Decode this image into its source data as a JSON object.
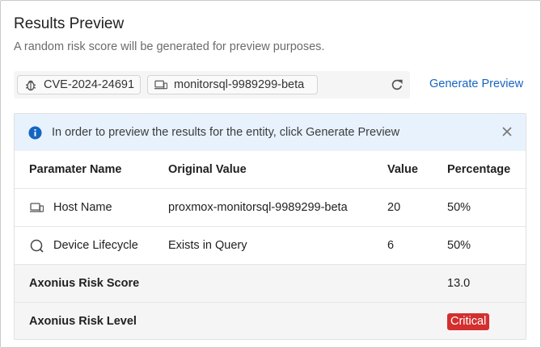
{
  "header": {
    "title": "Results Preview",
    "subtitle": "A random risk score will be generated for preview purposes."
  },
  "chips": {
    "cve": {
      "label": "CVE-2024-24691",
      "icon": "bug-icon"
    },
    "host": {
      "label": "monitorsql-9989299-beta",
      "icon": "device-icon"
    }
  },
  "actions": {
    "refresh_icon": "refresh-icon",
    "generate_preview": "Generate Preview"
  },
  "banner": {
    "text": "In order to preview the results for the entity, click Generate Preview",
    "icon": "info-icon"
  },
  "table": {
    "columns": [
      "Paramater Name",
      "Original Value",
      "Value",
      "Percentage"
    ],
    "rows": [
      {
        "icon": "device-icon",
        "name": "Host Name",
        "original": "proxmox-monitorsql-9989299-beta",
        "value": "20",
        "percentage": "50%"
      },
      {
        "icon": "lifecycle-icon",
        "name": "Device Lifecycle",
        "original": "Exists in Query",
        "value": "6",
        "percentage": "50%"
      }
    ],
    "score": {
      "label": "Axonius Risk Score",
      "value": "13.0"
    },
    "level": {
      "label": "Axonius Risk Level",
      "value": "Critical"
    }
  },
  "colors": {
    "accent": "#1565c0",
    "banner_bg": "#e8f2fd",
    "critical": "#d32f2f"
  }
}
